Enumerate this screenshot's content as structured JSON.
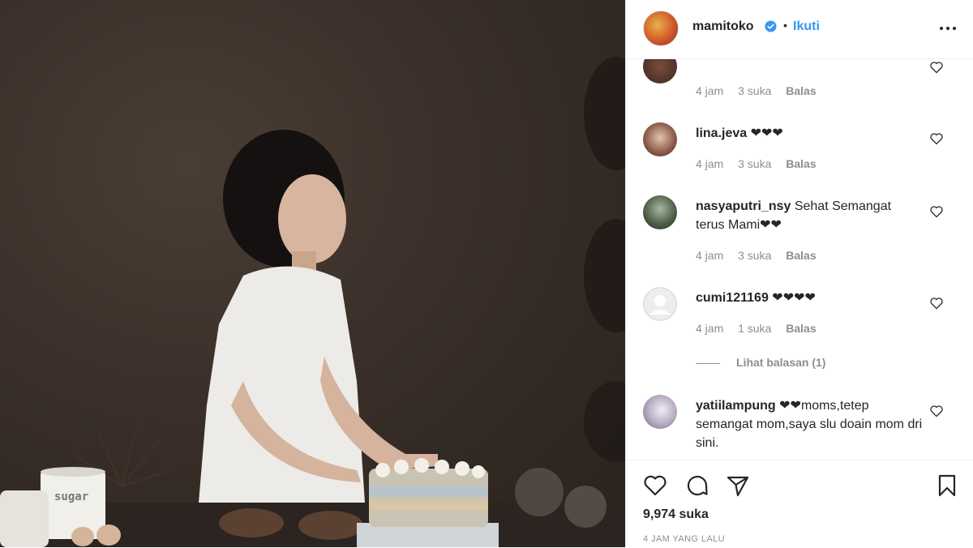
{
  "post": {
    "username": "mamitoko",
    "follow_label": "Ikuti",
    "separator": "•",
    "likes": "9,974 suka",
    "posted_time": "4 JAM YANG LALU",
    "photo_text": "sugar"
  },
  "comments": [
    {
      "username": "",
      "text": "",
      "time": "4 jam",
      "likes": "3 suka",
      "reply": "Balas"
    },
    {
      "username": "lina.jeva",
      "text": " ❤❤❤",
      "time": "4 jam",
      "likes": "3 suka",
      "reply": "Balas"
    },
    {
      "username": "nasyaputri_nsy",
      "text": " Sehat Semangat terus Mami❤❤",
      "time": "4 jam",
      "likes": "3 suka",
      "reply": "Balas"
    },
    {
      "username": "cumi121169",
      "text": " ❤❤❤❤",
      "time": "4 jam",
      "likes": "1 suka",
      "reply": "Balas",
      "view_replies": "Lihat balasan (1)"
    },
    {
      "username": "yatiilampung",
      "text": " ❤❤moms,tetep semangat mom,saya slu doain mom dri sini."
    }
  ],
  "icons": {
    "verified": "verified-badge-icon",
    "more": "more-options-icon",
    "like": "heart-icon",
    "comment": "comment-icon",
    "share": "share-icon",
    "save": "bookmark-icon"
  },
  "colors": {
    "accent": "#3897f0",
    "muted": "#8e8e8e",
    "text": "#262626"
  }
}
